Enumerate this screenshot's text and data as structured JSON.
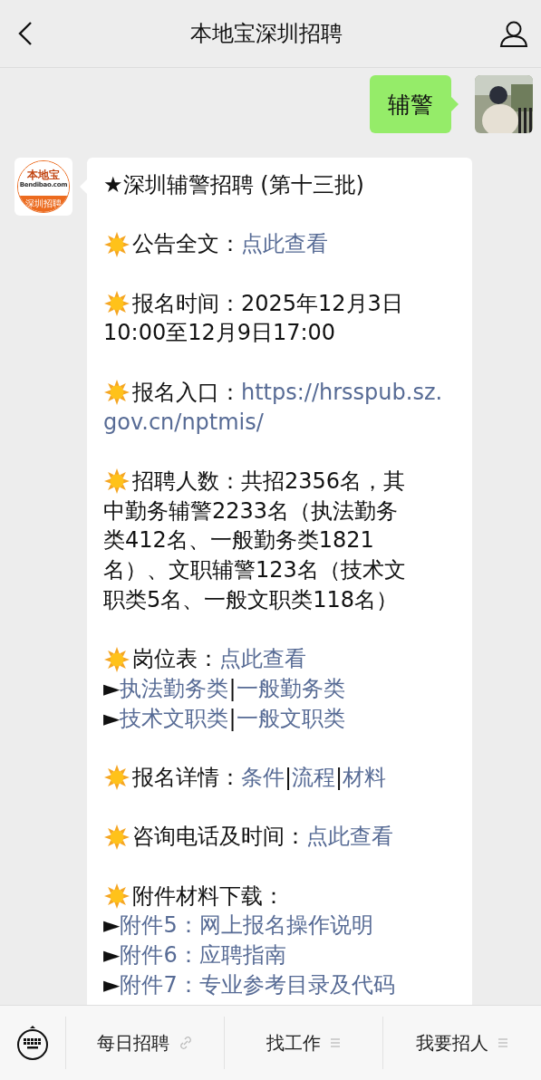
{
  "header": {
    "title": "本地宝深圳招聘"
  },
  "messages": [
    {
      "kind": "user",
      "text": "辅警"
    },
    {
      "kind": "bot",
      "logo": {
        "brand": "本地宝",
        "site": "Bendibao.com",
        "tagline": "深圳招聘"
      },
      "blocks": [
        {
          "kind": "title",
          "lines": [
            [
              {
                "text": "★深圳辅警招聘 (第十三批)",
                "link": false
              }
            ]
          ]
        },
        {
          "kind": "sun",
          "lines": [
            [
              {
                "text": "公告全文：",
                "link": false
              },
              {
                "text": "点此查看",
                "link": true
              }
            ]
          ]
        },
        {
          "kind": "sun",
          "lines": [
            [
              {
                "text": "报名时间：2025年12月3日",
                "link": false
              }
            ],
            [
              {
                "text": "10:00至12月9日17:00",
                "link": false
              }
            ]
          ]
        },
        {
          "kind": "sun",
          "lines": [
            [
              {
                "text": "报名入口：",
                "link": false
              },
              {
                "text": "https://hrsspub.sz.",
                "link": true
              }
            ],
            [
              {
                "text": "gov.cn/nptmis/",
                "link": true
              }
            ]
          ]
        },
        {
          "kind": "sun",
          "lines": [
            [
              {
                "text": "招聘人数：共招2356名，其",
                "link": false
              }
            ],
            [
              {
                "text": "中勤务辅警2233名（执法勤务",
                "link": false
              }
            ],
            [
              {
                "text": "类412名、一般勤务类1821",
                "link": false
              }
            ],
            [
              {
                "text": "名）、文职辅警123名（技术文",
                "link": false
              }
            ],
            [
              {
                "text": "职类5名、一般文职类118名）",
                "link": false
              }
            ]
          ]
        },
        {
          "kind": "sun",
          "lines": [
            [
              {
                "text": "岗位表：",
                "link": false
              },
              {
                "text": "点此查看",
                "link": true
              }
            ],
            [
              {
                "text": "►",
                "link": false
              },
              {
                "text": "执法勤务类",
                "link": true
              },
              {
                "text": " | ",
                "link": false
              },
              {
                "text": "一般勤务类",
                "link": true
              }
            ],
            [
              {
                "text": "►",
                "link": false
              },
              {
                "text": "技术文职类",
                "link": true
              },
              {
                "text": " | ",
                "link": false
              },
              {
                "text": "一般文职类",
                "link": true
              }
            ]
          ]
        },
        {
          "kind": "sun",
          "lines": [
            [
              {
                "text": "报名详情：",
                "link": false
              },
              {
                "text": "条件",
                "link": true
              },
              {
                "text": " | ",
                "link": false
              },
              {
                "text": "流程",
                "link": true
              },
              {
                "text": " | ",
                "link": false
              },
              {
                "text": "材料",
                "link": true
              }
            ]
          ]
        },
        {
          "kind": "sun",
          "lines": [
            [
              {
                "text": "咨询电话及时间：",
                "link": false
              },
              {
                "text": "点此查看",
                "link": true
              }
            ]
          ]
        },
        {
          "kind": "sun",
          "lines": [
            [
              {
                "text": "附件材料下载：",
                "link": false
              }
            ],
            [
              {
                "text": "►",
                "link": false
              },
              {
                "text": "附件5：网上报名操作说明",
                "link": true
              }
            ],
            [
              {
                "text": "►",
                "link": false
              },
              {
                "text": "附件6：应聘指南",
                "link": true
              }
            ],
            [
              {
                "text": "►",
                "link": false
              },
              {
                "text": "附件7：专业参考目录及代码",
                "link": true
              }
            ]
          ]
        }
      ]
    }
  ],
  "menu": [
    {
      "label": "每日招聘",
      "kind": "link"
    },
    {
      "label": "找工作",
      "kind": "submenu"
    },
    {
      "label": "我要招人",
      "kind": "submenu"
    }
  ]
}
